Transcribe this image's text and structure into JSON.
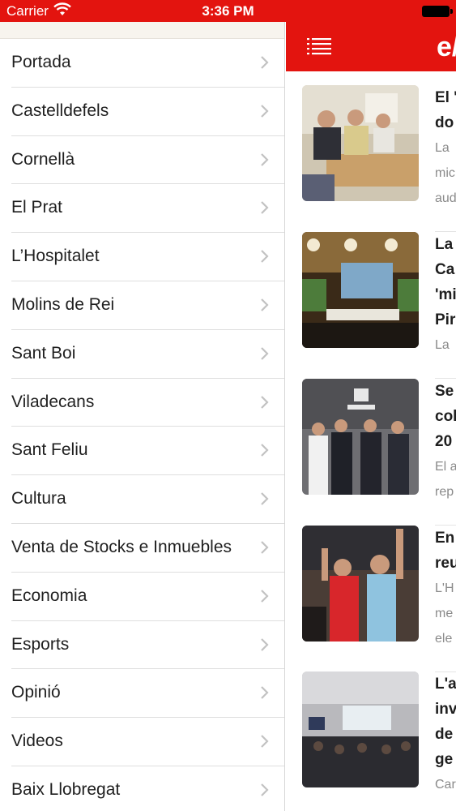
{
  "status_bar": {
    "carrier": "Carrier",
    "time": "3:36 PM"
  },
  "menu": {
    "items": [
      {
        "label": "Portada"
      },
      {
        "label": "Castelldefels"
      },
      {
        "label": "Cornellà"
      },
      {
        "label": "El Prat"
      },
      {
        "label": "L’Hospitalet"
      },
      {
        "label": "Molins de Rei"
      },
      {
        "label": "Sant Boi"
      },
      {
        "label": "Viladecans"
      },
      {
        "label": "Sant Feliu"
      },
      {
        "label": "Cultura"
      },
      {
        "label": "Venta de Stocks e Inmuebles"
      },
      {
        "label": "Economia"
      },
      {
        "label": "Esports"
      },
      {
        "label": "Opinió"
      },
      {
        "label": "Videos"
      },
      {
        "label": "Baix Llobregat"
      }
    ]
  },
  "header": {
    "brand": "e/"
  },
  "articles": [
    {
      "title": "El '\ndo",
      "excerpt": "La\nmic\naud",
      "image": "photo-meeting-table"
    },
    {
      "title": "La\nCa\n'mi\nPir",
      "excerpt": "La",
      "image": "photo-event-stage"
    },
    {
      "title": "Se\ncol\n20",
      "excerpt": "El a\nrep",
      "image": "photo-seat-handshake"
    },
    {
      "title": "En\nreu",
      "excerpt": "L'H\nme\nele",
      "image": "photo-campaign-rally"
    },
    {
      "title": "L'a\ninv\nde\nge",
      "excerpt": "Car",
      "image": "photo-conference-room"
    }
  ],
  "colors": {
    "accent": "#e3140f"
  }
}
